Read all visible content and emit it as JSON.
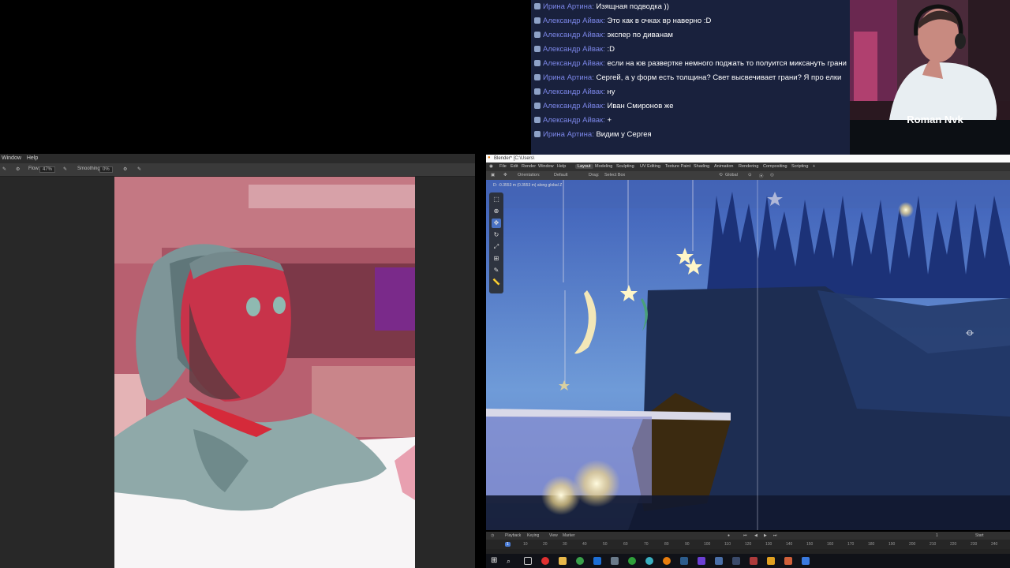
{
  "photoshop": {
    "menu": [
      "Window",
      "Help"
    ],
    "options": {
      "flow_label": "Flow:",
      "flow_value": "47%",
      "smoothing_label": "Smoothing:",
      "smoothing_value": "0%"
    }
  },
  "chat": {
    "messages": [
      {
        "user": "Ирина Артина",
        "text": "Изящная подводка ))"
      },
      {
        "user": "Александр Айвак",
        "text": "Это как в очках вр наверно :D"
      },
      {
        "user": "Александр Айвак",
        "text": "экспер по диванам"
      },
      {
        "user": "Александр Айвак",
        "text": ":D"
      },
      {
        "user": "Александр Айвак",
        "text": "если на юв развертке немного поджать то полуится миксануть грани"
      },
      {
        "user": "Ирина Артина",
        "text": "Сергей, а у форм есть толщина? Свет высвечивает грани? Я про елки"
      },
      {
        "user": "Александр Айвак",
        "text": "ну"
      },
      {
        "user": "Александр Айвак",
        "text": "Иван Смиронов же"
      },
      {
        "user": "Александр Айвак",
        "text": "+"
      },
      {
        "user": "Ирина Артина",
        "text": "Видим у Сергея"
      }
    ]
  },
  "webcam": {
    "name": "Roman Nvk"
  },
  "blender": {
    "title": "Blender* [C:\\Users\\",
    "menu": [
      "File",
      "Edit",
      "Render",
      "Window",
      "Help"
    ],
    "workspaces": [
      "Layout",
      "Modeling",
      "Sculpting",
      "UV Editing",
      "Texture Paint",
      "Shading",
      "Animation",
      "Rendering",
      "Compositing",
      "Scripting"
    ],
    "header": {
      "orientation_label": "Orientation:",
      "orientation_value": "Default",
      "drag_label": "Drag:",
      "drag_value": "Select Box",
      "transform_value": "Global"
    },
    "status_text": "D: -0.3553 m (0.3553 m) along global Z",
    "timeline": {
      "menu": [
        "Playback",
        "Keying",
        "View",
        "Marker"
      ],
      "start_label": "Start",
      "current_frame": "1",
      "ruler": [
        "1",
        "10",
        "20",
        "30",
        "40",
        "50",
        "60",
        "70",
        "80",
        "90",
        "100",
        "110",
        "120",
        "130",
        "140",
        "150",
        "160",
        "170",
        "180",
        "190",
        "200",
        "210",
        "220",
        "230",
        "240"
      ]
    }
  }
}
